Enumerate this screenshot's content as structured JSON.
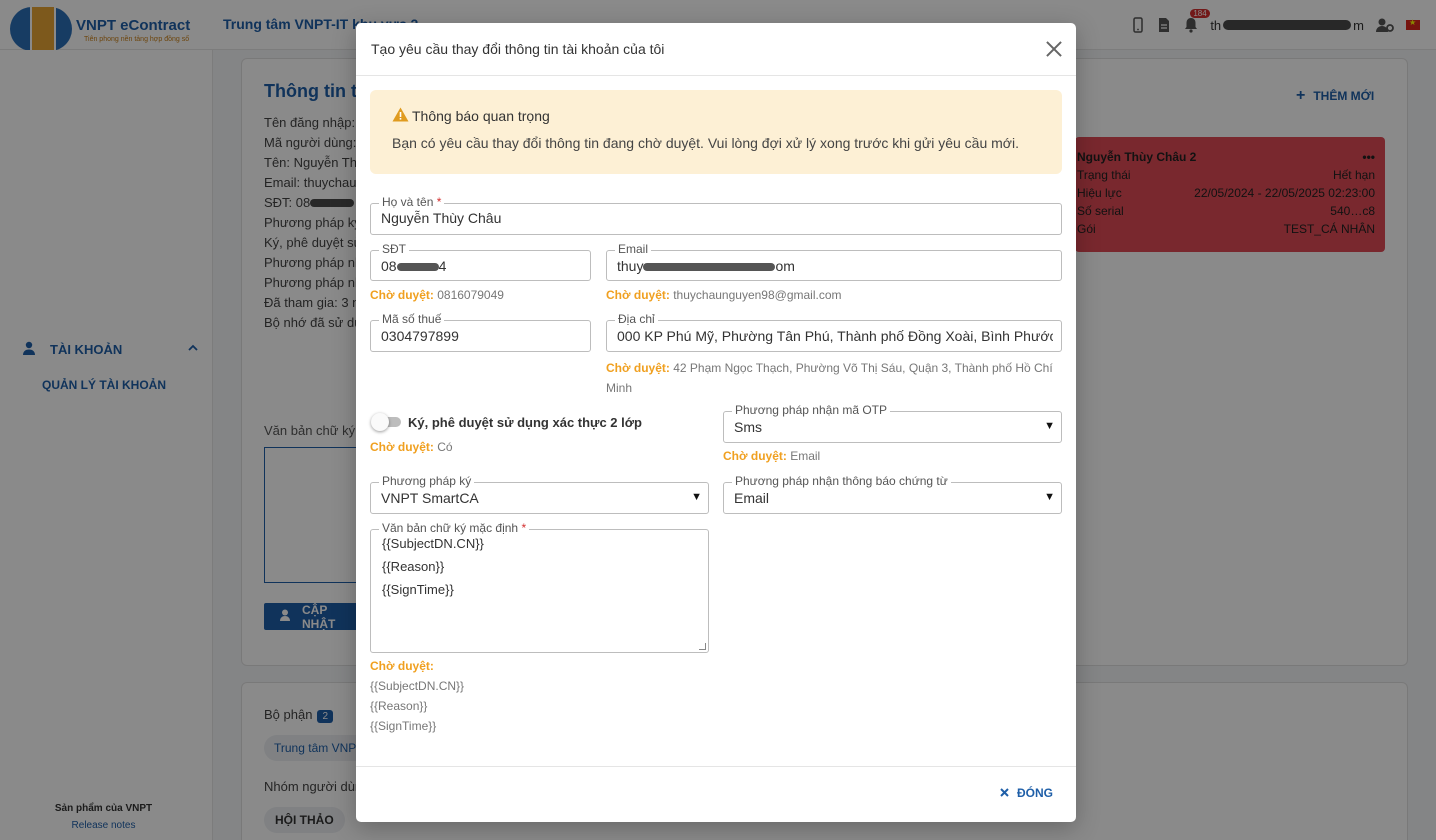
{
  "app": {
    "logo_title": "VNPT eContract",
    "logo_subtitle": "Tiên phong nền tảng hợp đồng số",
    "center_title": "Trung tâm VNPT-IT khu vực 2",
    "notification_count": "184",
    "user_email_suffix": "m"
  },
  "sidebar": {
    "account_label": "TÀI KHOẢN",
    "account_manage": "QUẢN LÝ TÀI KHOẢN",
    "product_of": "Sản phẩm của VNPT",
    "release_notes": "Release notes"
  },
  "background": {
    "card_title": "Thông tin tà",
    "info_lines": [
      "Tên đăng nhập: t",
      "Mã người dùng: (",
      "Tên: Nguyễn Thù",
      "Email: thuychau.",
      "SĐT: 08",
      "Phương pháp ký",
      "Ký, phê duyệt sử",
      "Phương pháp nh",
      "Phương pháp nh",
      "Đã tham gia: 3 n",
      "Bộ nhớ đã sử dụ"
    ],
    "add_new": "THÊM MỚI",
    "cert": {
      "name": "Nguyễn Thùy Châu 2",
      "rows": [
        {
          "label": "Trạng thái",
          "value": "Hết hạn"
        },
        {
          "label": "Hiệu lực",
          "value": "22/05/2024 - 22/05/2025 02:23:00"
        },
        {
          "label": "Số serial",
          "value": "540…c8"
        },
        {
          "label": "Gói",
          "value": "TEST_CÁ NHÂN"
        }
      ]
    },
    "sig_label": "Văn bản chữ ký n",
    "update_button": "CẬP NHẬT",
    "dept_label": "Bộ phận",
    "dept_count": "2",
    "dept_chip": "Trung tâm VNPT",
    "group_label": "Nhóm người dùn",
    "group_chip": "HỘI THẢO"
  },
  "modal": {
    "title": "Tạo yêu cầu thay đổi thông tin tài khoản của tôi",
    "notice_title": "Thông báo quan trọng",
    "notice_text": "Bạn có yêu cầu thay đổi thông tin đang chờ duyệt. Vui lòng đợi xử lý xong trước khi gửi yêu cầu mới.",
    "pending_label": "Chờ duyệt:",
    "fullname": {
      "label": "Họ và tên",
      "value": "Nguyễn Thùy Châu"
    },
    "phone": {
      "label": "SĐT",
      "value_start": "08",
      "value_end": "4",
      "pending": "0816079049"
    },
    "email": {
      "label": "Email",
      "value_start": "thuy",
      "value_end": "om",
      "pending": "thuychaunguyen98@gmail.com"
    },
    "tax": {
      "label": "Mã số thuế",
      "value": "0304797899"
    },
    "address": {
      "label": "Địa chỉ",
      "value": "000 KP Phú Mỹ, Phường Tân Phú, Thành phố Đồng Xoài, Bình Phước",
      "pending_line1": "42 Phạm Ngọc Thạch, Phường Võ Thị Sáu, Quận 3, Thành phố Hồ Chí",
      "pending_line2": "Minh"
    },
    "two_factor": {
      "label": "Ký, phê duyệt sử dụng xác thực 2 lớp",
      "pending": "Có"
    },
    "otp": {
      "label": "Phương pháp nhận mã OTP",
      "value": "Sms",
      "pending": "Email"
    },
    "sign_method": {
      "label": "Phương pháp ký",
      "value": "VNPT SmartCA"
    },
    "notify_method": {
      "label": "Phương pháp nhận thông báo chứng từ",
      "value": "Email"
    },
    "signature_text": {
      "label": "Văn bản chữ ký mặc định",
      "lines": [
        "{{SubjectDN.CN}}",
        "{{Reason}}",
        "{{SignTime}}"
      ],
      "pending_lines": [
        "{{SubjectDN.CN}}",
        "{{Reason}}",
        "{{SignTime}}"
      ]
    },
    "close_button": "ĐÓNG"
  },
  "colors": {
    "brand_blue": "#1f5fa8",
    "pending_orange": "#f0a020",
    "notice_bg": "#fdf0d5",
    "cert_red": "#e04a55"
  },
  "icons": [
    "warning-icon",
    "close-icon",
    "user-icon",
    "chevron-up-icon",
    "plus-icon",
    "bell-icon",
    "mobile-icon",
    "document-icon",
    "user-settings-icon",
    "flag-icon",
    "more-icon"
  ]
}
